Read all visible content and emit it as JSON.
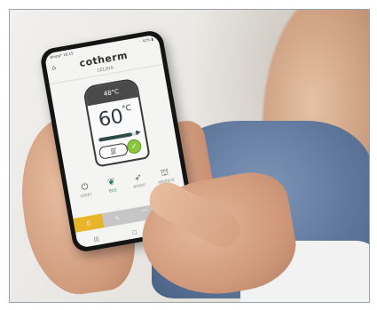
{
  "status_bar": {
    "left": "Bmpp* 16:15",
    "right": "◦ 41% ▮"
  },
  "app": {
    "brand": "cotherm",
    "subtitle": "CELAYA"
  },
  "tank": {
    "setpoint": "48°C",
    "temperature": "60",
    "unit": "°C",
    "level_fraction": 0.82
  },
  "modes": [
    {
      "label": "ARRET",
      "icon": "power-icon",
      "glyph": "⏻",
      "active": false
    },
    {
      "label": "ECO",
      "icon": "leaf-icon",
      "glyph": "❦",
      "active": true
    },
    {
      "label": "BOOST",
      "icon": "rocket-icon",
      "glyph": "➶",
      "active": false
    },
    {
      "label": "ABSENCE",
      "icon": "suitcase-icon",
      "glyph": "⛫",
      "active": false
    }
  ],
  "bottom_tabs": [
    {
      "icon": "tank-icon",
      "glyph": "▯",
      "active": true
    },
    {
      "icon": "chart-icon",
      "glyph": "∿",
      "active": false
    },
    {
      "icon": "curve-icon",
      "glyph": "⌒",
      "active": false
    },
    {
      "icon": "more-icon",
      "glyph": "···",
      "active": false
    }
  ],
  "nav": [
    "|||",
    "▢",
    "<"
  ],
  "colors": {
    "accent_green": "#2d6f63",
    "eco_green": "#8cc63f",
    "active_tab": "#e8b429"
  }
}
